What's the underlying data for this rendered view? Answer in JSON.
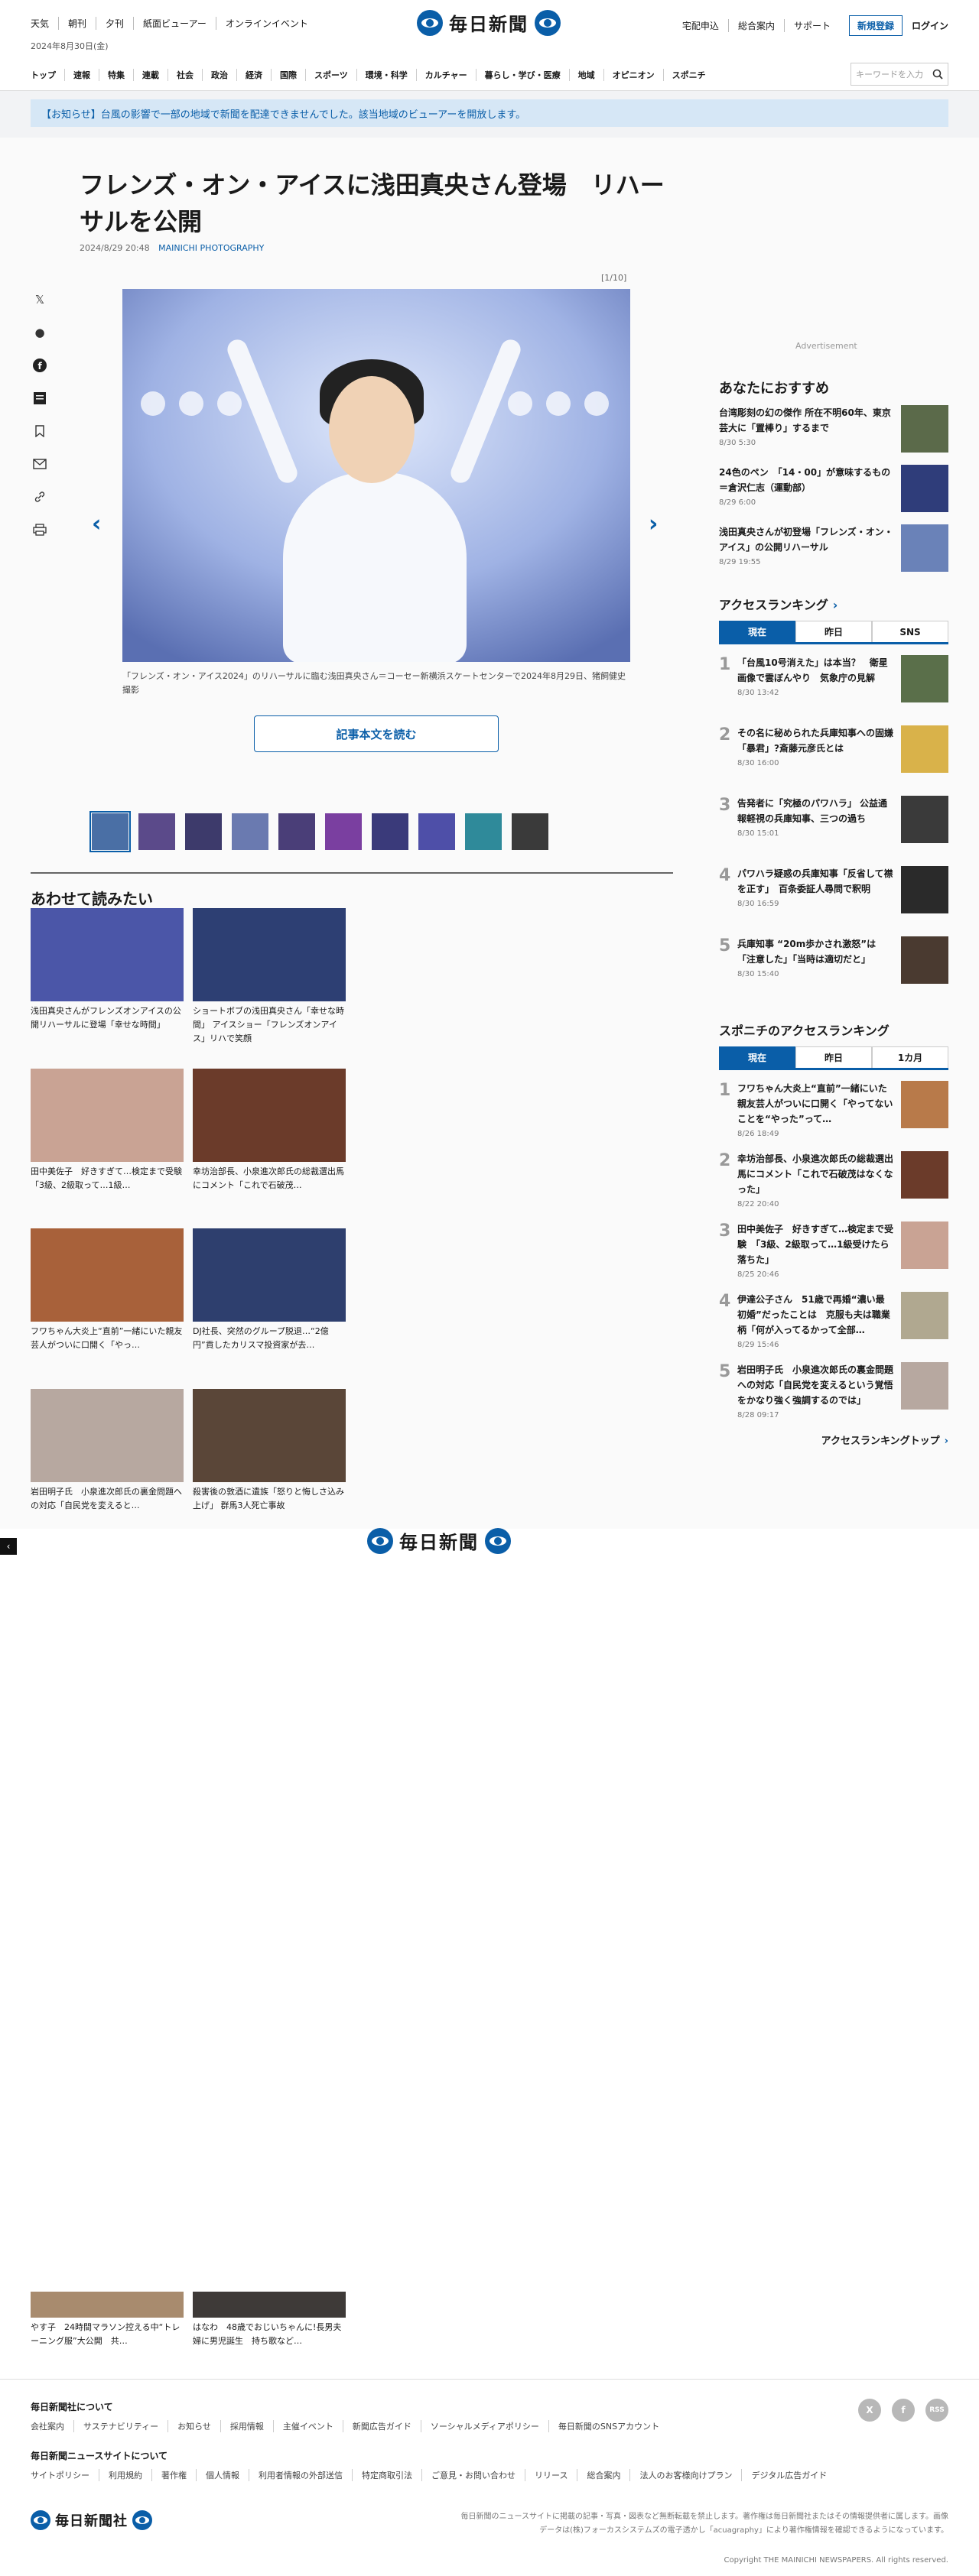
{
  "header": {
    "top_links": [
      "天気",
      "朝刊",
      "夕刊",
      "紙面ビューアー",
      "オンラインイベント"
    ],
    "date": "2024年8月30日(金)",
    "logo_text": "毎日新聞",
    "right_links": [
      "宅配申込",
      "総合案内",
      "サポート"
    ],
    "register_label": "新規登録",
    "login_label": "ログイン",
    "nav": [
      "トップ",
      "速報",
      "特集",
      "連載",
      "社会",
      "政治",
      "経済",
      "国際",
      "スポーツ",
      "環境・科学",
      "カルチャー",
      "暮らし・学び・医療",
      "地域",
      "オピニオン",
      "スポニチ"
    ],
    "search_placeholder": "キーワードを入力",
    "search_icon": "search-icon"
  },
  "notice": "【お知らせ】台風の影響で一部の地域で新聞を配達できませんでした。該当地域のビューアーを開放します。",
  "article": {
    "title": "フレンズ・オン・アイスに浅田真央さん登場　リハーサルを公開",
    "datetime": "2024/8/29 20:48",
    "source": "MAINICHI PHOTOGRAPHY",
    "counter": "[1/10]",
    "caption": "「フレンズ・オン・アイス2024」のリハーサルに臨む浅田真央さん＝コーセー新横浜スケートセンターで2024年8月29日、猪飼健史撮影",
    "read_button": "記事本文を読む",
    "share_icons": [
      "x-icon",
      "hatena-icon",
      "facebook-icon",
      "note-icon",
      "bookmark-icon",
      "mail-icon",
      "link-icon",
      "print-icon"
    ],
    "thumb_colors": [
      "#4a6fa5",
      "#5b4a8a",
      "#3d3a6b",
      "#6a7ab0",
      "#4a3e78",
      "#7a3fa0",
      "#3a3a7a",
      "#4e4fa8",
      "#2f8a9a",
      "#3a3a3a"
    ]
  },
  "related": {
    "title": "あわせて読みたい",
    "items": [
      {
        "title": "浅田真央さんがフレンズオンアイスの公開リハーサルに登場「幸せな時間」",
        "color": "#4b56a8"
      },
      {
        "title": "ショートボブの浅田真央さん「幸せな時間」 アイスショー「フレンズオンアイス」リハで笑顔",
        "color": "#2d3f73"
      },
      {
        "title": "田中美佐子　好きすぎて…検定まで受験　「3級、2級取って…1級…",
        "color": "#c9a394"
      },
      {
        "title": "幸坊治部長、小泉進次郎氏の総裁選出馬にコメント「これで石破茂…",
        "color": "#6b3b2a"
      },
      {
        "title": "フワちゃん大炎上“直前”一緒にいた親友芸人がついに口開く「やっ…",
        "color": "#a8613a"
      },
      {
        "title": "DJ社長、突然のグループ脱退…“2億円”貢したカリスマ投資家が去…",
        "color": "#2e3f6e"
      },
      {
        "title": "岩田明子氏　小泉進次郎氏の裏金問題への対応「自民党を変えると…",
        "color": "#b7a8a0"
      },
      {
        "title": "殺害後の敦酒に遺族「怒りと悔しさ込み上げ」 群馬3人死亡事故",
        "color": "#5a4638"
      }
    ],
    "bottom_items": [
      {
        "title": "やす子　24時間マラソン控える中“トレーニング服”大公開　共…",
        "color": "#a88b6e"
      },
      {
        "title": "はなわ　48歳でおじいちゃんに!長男夫婦に男児誕生　持ち歌など…",
        "color": "#3e3a38"
      }
    ]
  },
  "sidebar": {
    "ad_label": "Advertisement",
    "recommend_title": "あなたにおすすめ",
    "recommend": [
      {
        "title": "台湾彫刻の幻の傑作 所在不明60年、東京芸大に「置棒り」するまで",
        "date": "8/30 5:30",
        "color": "#5b6a4a"
      },
      {
        "title": "24色のペン　「14・00」が意味するもの＝倉沢仁志（運動部）",
        "date": "8/29 6:00",
        "color": "#2f3d7a"
      },
      {
        "title": "浅田真央さんが初登場「フレンズ・オン・アイス」の公開リハーサル",
        "date": "8/29 19:55",
        "color": "#6a82b8"
      }
    ],
    "access_title": "アクセスランキング",
    "access_tabs": [
      "現在",
      "昨日",
      "SNS"
    ],
    "access": [
      {
        "title": "「台風10号消えた」は本当？　衛星画像で雲ぼんやり　気象庁の見解",
        "date": "8/30 13:42",
        "color": "#5a6f4a"
      },
      {
        "title": "その名に秘められた兵庫知事への固嫌「暴君」?斎藤元彦氏とは",
        "date": "8/30 16:00",
        "color": "#d9b24a"
      },
      {
        "title": "告発者に「究極のパワハラ」 公益通報軽視の兵庫知事、三つの過ち",
        "date": "8/30 15:01",
        "color": "#3a3a3a"
      },
      {
        "title": "パワハラ疑惑の兵庫知事「反省して襟を正す」　百条委証人尋問で釈明",
        "date": "8/30 16:59",
        "color": "#2a2a2a"
      },
      {
        "title": "兵庫知事 “20m歩かされ激怒”は「注意した」「当時は適切だと」",
        "date": "8/30 15:40",
        "color": "#4a3a30"
      }
    ],
    "sponichi_title": "スポニチのアクセスランキング",
    "sponichi_tabs": [
      "現在",
      "昨日",
      "1カ月"
    ],
    "sponichi": [
      {
        "title": "フワちゃん大炎上“直前”一緒にいた親友芸人がついに口開く「やってないことを“やった”って…",
        "date": "8/26 18:49",
        "color": "#b87a4a"
      },
      {
        "title": "幸坊治部長、小泉進次郎氏の総裁選出馬にコメント「これで石破茂はなくなった」",
        "date": "8/22 20:40",
        "color": "#6b3b2a"
      },
      {
        "title": "田中美佐子　好きすぎて…検定まで受験　「3級、2級取って…1級受けたら落ちた」",
        "date": "8/25 20:46",
        "color": "#c9a394"
      },
      {
        "title": "伊達公子さん　51歳で再婚“濃い最初婚”だったことは　克服も夫は職業柄「何が入ってるかって全部…",
        "date": "8/29 15:46",
        "color": "#b0a890"
      },
      {
        "title": "岩田明子氏　小泉進次郎氏の裏金問題への対応「自民党を変えるという覚悟をかなり強く強調するのでは」",
        "date": "8/28 09:17",
        "color": "#b7a8a0"
      }
    ],
    "ranking_more": "アクセスランキングトップ"
  },
  "overlay": {
    "logo_text": "毎日新聞"
  },
  "footer": {
    "about_title": "毎日新聞社について",
    "about_links": [
      "会社案内",
      "サステナビリティー",
      "お知らせ",
      "採用情報",
      "主催イベント",
      "新聞広告ガイド",
      "ソーシャルメディアポリシー",
      "毎日新聞のSNSアカウント"
    ],
    "site_title": "毎日新聞ニュースサイトについて",
    "site_links": [
      "サイトポリシー",
      "利用規約",
      "著作権",
      "個人情報",
      "利用者情報の外部送信",
      "特定商取引法",
      "ご意見・お問い合わせ",
      "リリース",
      "総合案内",
      "法人のお客様向けプラン",
      "デジタル広告ガイド"
    ],
    "logo_text": "毎日新聞社",
    "note": "毎日新聞のニュースサイトに掲載の記事・写真・図表など無断転載を禁止します。著作権は毎日新聞社またはその情報提供者に属します。画像データは(株)フォーカスシステムズの電子透かし「acuagraphy」により著作権情報を確認できるようになっています。",
    "copyright": "Copyright THE MAINICHI NEWSPAPERS. All rights reserved.",
    "social": [
      "X",
      "f",
      "RSS"
    ]
  }
}
